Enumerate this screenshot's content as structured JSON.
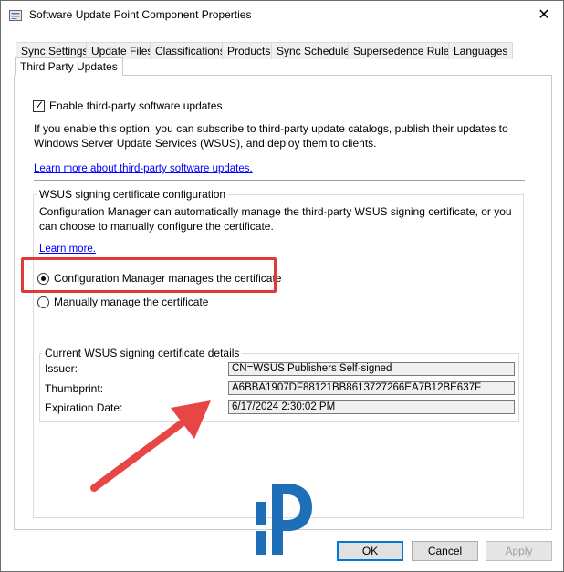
{
  "window": {
    "title": "Software Update Point Component Properties",
    "close_glyph": "✕"
  },
  "tabs": [
    {
      "label": "Sync Settings"
    },
    {
      "label": "Update Files"
    },
    {
      "label": "Classifications"
    },
    {
      "label": "Products"
    },
    {
      "label": "Sync Schedule"
    },
    {
      "label": "Supersedence Rules"
    },
    {
      "label": "Languages"
    },
    {
      "label": "Third Party Updates",
      "active": true
    }
  ],
  "third_party": {
    "enable_label": "Enable third-party software updates",
    "enable_checked": true,
    "description": "If you enable this option, you can subscribe to third-party update catalogs, publish their updates to Windows Server Update Services (WSUS), and deploy them to clients.",
    "learn_more_link": "Learn more about third-party software updates."
  },
  "signing": {
    "group_title": "WSUS signing certificate configuration",
    "description": "Configuration Manager can automatically manage the third-party WSUS signing certificate, or you can choose to manually configure the certificate.",
    "learn_more": "Learn more.",
    "options": [
      {
        "label": "Configuration Manager manages the certificate",
        "selected": true
      },
      {
        "label": "Manually manage the certificate",
        "selected": false
      }
    ]
  },
  "details": {
    "group_title": "Current WSUS signing certificate details",
    "issuer_label": "Issuer:",
    "issuer_value": "CN=WSUS Publishers Self-signed",
    "thumbprint_label": "Thumbprint:",
    "thumbprint_value": "A6BBA1907DF88121BB8613727266EA7B12BE637F",
    "expiration_label": "Expiration Date:",
    "expiration_value": "6/17/2024 2:30:02 PM"
  },
  "buttons": {
    "ok": "OK",
    "cancel": "Cancel",
    "apply": "Apply"
  },
  "colors": {
    "highlight": "#e03a3a",
    "arrow": "#e84545",
    "logo": "#1f6fb8",
    "link": "#0000ff"
  },
  "icons": {
    "check": "✓",
    "app_icon": "update-point-icon",
    "logo": "prajwal-logo-icon"
  }
}
